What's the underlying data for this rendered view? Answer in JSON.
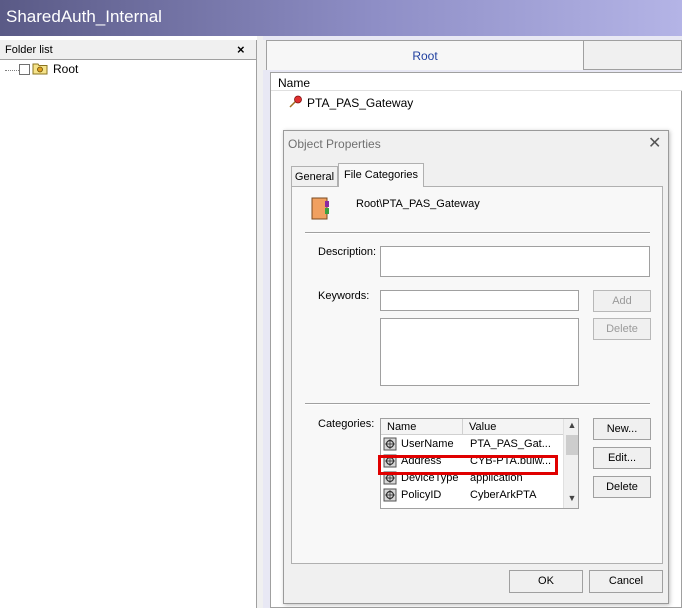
{
  "window": {
    "title": "SharedAuth_Internal"
  },
  "folder_list": {
    "title": "Folder list",
    "close_glyph": "×",
    "tree": [
      {
        "label": "Root",
        "icon": "folder-icon",
        "checked": false
      }
    ]
  },
  "right_pane": {
    "tab_label": "Root",
    "columns": [
      "Name"
    ],
    "items": [
      {
        "label": "PTA_PAS_Gateway",
        "icon": "gateway-icon"
      }
    ]
  },
  "dialog": {
    "title": "Object Properties",
    "close_glyph": "✕",
    "tabs": [
      "General",
      "File Categories"
    ],
    "active_tab": "File Categories",
    "object_path": "Root\\PTA_PAS_Gateway",
    "description_label": "Description:",
    "description_value": "",
    "keywords_label": "Keywords:",
    "keywords_value": "",
    "add_label": "Add",
    "delete_keyword_label": "Delete",
    "categories_label": "Categories:",
    "categories_columns": [
      "Name",
      "Value"
    ],
    "categories": [
      {
        "name": "UserName",
        "value": "PTA_PAS_Gat..."
      },
      {
        "name": "Address",
        "value": "CYB-PTA.bulw..."
      },
      {
        "name": "DeviceType",
        "value": "application"
      },
      {
        "name": "PolicyID",
        "value": "CyberArkPTA"
      }
    ],
    "highlighted_category": "Address",
    "highlight_color": "#e00000",
    "new_label": "New...",
    "edit_label": "Edit...",
    "delete_category_label": "Delete",
    "ok_label": "OK",
    "cancel_label": "Cancel",
    "scroll_up_glyph": "▲",
    "scroll_down_glyph": "▼"
  }
}
